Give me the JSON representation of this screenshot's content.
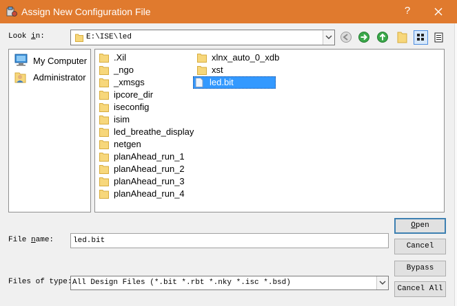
{
  "window": {
    "title": "Assign New Configuration File",
    "help_glyph": "?",
    "accent_color": "#e07a2e"
  },
  "look_in": {
    "label_pre": "Look ",
    "label_key": "i",
    "label_post": "n:",
    "path": "E:\\ISE\\led"
  },
  "toolbar": {
    "icons": [
      "back-icon",
      "forward-icon",
      "up-folder-icon",
      "new-folder-icon",
      "list-view-icon",
      "detail-view-icon"
    ]
  },
  "places": [
    {
      "label": "My Computer",
      "icon": "computer-icon"
    },
    {
      "label": "Administrator",
      "icon": "user-folder-icon"
    }
  ],
  "files": {
    "column1": [
      ".Xil",
      "_ngo",
      "_xmsgs",
      "ipcore_dir",
      "iseconfig",
      "isim",
      "led_breathe_display",
      "netgen",
      "planAhead_run_1",
      "planAhead_run_2",
      "planAhead_run_3",
      "planAhead_run_4"
    ],
    "column2": [
      "xlnx_auto_0_xdb",
      "xst"
    ],
    "selected_file": "led.bit"
  },
  "file_name": {
    "label_pre": "File ",
    "label_key": "n",
    "label_post": "ame:",
    "value": "led.bit"
  },
  "file_type": {
    "label": "Files of type:",
    "value": "All Design Files (*.bit *.rbt *.nky *.isc *.bsd)"
  },
  "buttons": {
    "open_key": "O",
    "open_rest": "pen",
    "cancel": "Cancel",
    "bypass": "Bypass",
    "cancel_all": "Cancel All"
  }
}
